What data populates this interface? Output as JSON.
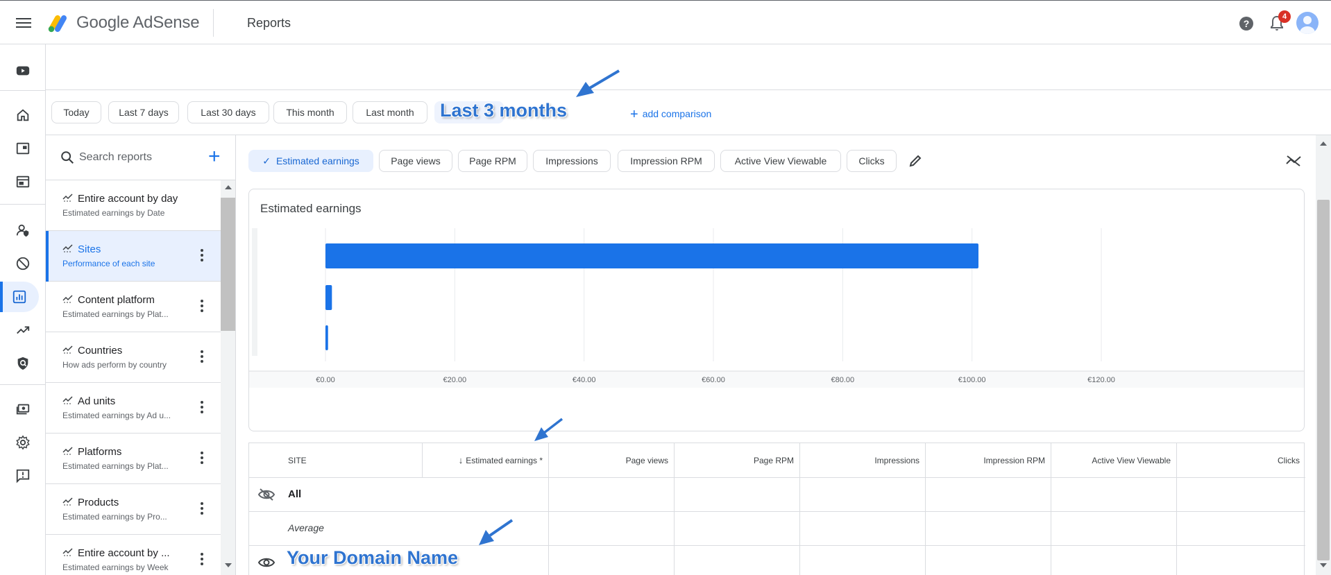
{
  "header": {
    "brand": "Google AdSense",
    "page_title": "Reports",
    "notification_count": "4"
  },
  "rail": {
    "icons": [
      "youtube-icon",
      "home-icon",
      "sites-icon",
      "ads-icon",
      "privacy-icon",
      "blocking-icon",
      "reports-icon",
      "optimization-icon",
      "policy-icon",
      "payments-icon",
      "settings-icon",
      "feedback-icon"
    ],
    "active": "reports-icon"
  },
  "date_range": {
    "chips": [
      "Today",
      "Last 7 days",
      "Last 30 days",
      "This month",
      "Last month"
    ],
    "selected_label": "Last 3 months",
    "add_comparison": "add comparison"
  },
  "reports_sidebar": {
    "search_placeholder": "Search reports",
    "items": [
      {
        "title": "Entire account by day",
        "subtitle": "Estimated earnings by Date"
      },
      {
        "title": "Sites",
        "subtitle": "Performance of each site"
      },
      {
        "title": "Content platform",
        "subtitle": "Estimated earnings by Plat..."
      },
      {
        "title": "Countries",
        "subtitle": "How ads perform by country"
      },
      {
        "title": "Ad units",
        "subtitle": "Estimated earnings by Ad u..."
      },
      {
        "title": "Platforms",
        "subtitle": "Estimated earnings by Plat..."
      },
      {
        "title": "Products",
        "subtitle": "Estimated earnings by Pro..."
      },
      {
        "title": "Entire account by ...",
        "subtitle": "Estimated earnings by Week"
      }
    ],
    "selected_index": 1
  },
  "metrics": {
    "chips": [
      "Estimated earnings",
      "Page views",
      "Page RPM",
      "Impressions",
      "Impression RPM",
      "Active View Viewable",
      "Clicks"
    ],
    "active": "Estimated earnings"
  },
  "chart_data": {
    "type": "bar",
    "orientation": "horizontal",
    "title": "Estimated earnings",
    "categories": [
      "",
      "",
      ""
    ],
    "values": [
      101,
      1,
      0.4
    ],
    "xlim": [
      0,
      120
    ],
    "x_tick_labels": [
      "€0.00",
      "€20.00",
      "€40.00",
      "€60.00",
      "€80.00",
      "€100.00",
      "€120.00"
    ],
    "color": "#1a73e8",
    "grid": true
  },
  "table": {
    "columns": [
      "SITE",
      "Estimated earnings *",
      "Page views",
      "Page RPM",
      "Impressions",
      "Impression RPM",
      "Active View Viewable",
      "Clicks"
    ],
    "sort_column": "Estimated earnings *",
    "rows": [
      {
        "label": "All"
      },
      {
        "label": "Average"
      },
      {
        "label": "Your Domain Name"
      }
    ]
  }
}
